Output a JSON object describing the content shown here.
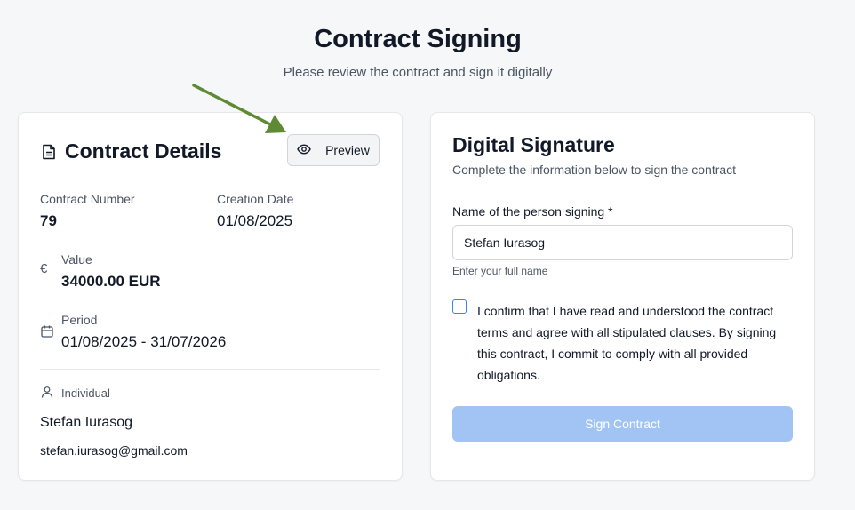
{
  "header": {
    "title": "Contract Signing",
    "subtitle": "Please review the contract and sign it digitally"
  },
  "details": {
    "title": "Contract Details",
    "preview_label": "Preview",
    "contract_number_label": "Contract Number",
    "contract_number": "79",
    "creation_date_label": "Creation Date",
    "creation_date": "01/08/2025",
    "value_label": "Value",
    "value": "34000.00 EUR",
    "currency_symbol": "€",
    "period_label": "Period",
    "period": "01/08/2025 - 31/07/2026",
    "party_type": "Individual",
    "party_name": "Stefan Iurasog",
    "party_email": "stefan.iurasog@gmail.com"
  },
  "signature": {
    "title": "Digital Signature",
    "subtitle": "Complete the information below to sign the contract",
    "name_label": "Name of the person signing *",
    "name_value": "Stefan Iurasog",
    "name_help": "Enter your full name",
    "confirm_text": "I confirm that I have read and understood the contract terms and agree with all stipulated clauses. By signing this contract, I commit to comply with all provided obligations.",
    "sign_button_label": "Sign Contract"
  },
  "colors": {
    "annotation_arrow": "#5f8a35",
    "sign_button_disabled": "#a1c4f5",
    "checkbox_border": "#3b82f6"
  },
  "icons": {
    "details": "document-icon",
    "preview": "eye-icon",
    "value": "euro-icon",
    "period": "calendar-icon",
    "party": "user-icon",
    "annotation": "arrow-icon"
  }
}
